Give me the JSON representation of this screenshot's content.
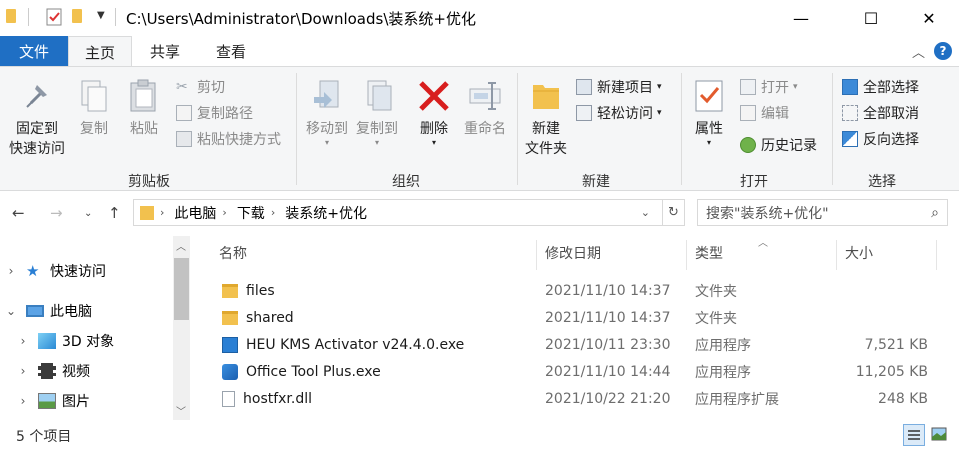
{
  "window": {
    "title": "C:\\Users\\Administrator\\Downloads\\装系统+优化",
    "controls": {
      "minimize": "—",
      "maximize": "☐",
      "close": "✕"
    }
  },
  "ribbon_tabs": {
    "file": "文件",
    "home": "主页",
    "share": "共享",
    "view": "查看"
  },
  "ribbon": {
    "clipboard": {
      "label": "剪贴板",
      "pin": [
        "固定到",
        "快速访问"
      ],
      "copy": "复制",
      "paste": "粘贴",
      "cut": "剪切",
      "copy_path": "复制路径",
      "paste_shortcut": "粘贴快捷方式"
    },
    "organize": {
      "label": "组织",
      "move_to": "移动到",
      "copy_to": "复制到",
      "delete": "删除",
      "rename": "重命名"
    },
    "new": {
      "label": "新建",
      "new_folder": [
        "新建",
        "文件夹"
      ],
      "new_item": "新建项目",
      "easy_access": "轻松访问"
    },
    "open": {
      "label": "打开",
      "properties": "属性",
      "open": "打开",
      "edit": "编辑",
      "history": "历史记录"
    },
    "select": {
      "label": "选择",
      "select_all": "全部选择",
      "select_none": "全部取消",
      "invert": "反向选择"
    }
  },
  "address": {
    "crumbs": [
      "此电脑",
      "下载",
      "装系统+优化"
    ],
    "search_placeholder": "搜索\"装系统+优化\""
  },
  "nav_pane": {
    "items": [
      {
        "label": "快速访问",
        "icon": "star-icon"
      },
      {
        "label": "此电脑",
        "icon": "computer-icon"
      },
      {
        "label": "3D 对象",
        "icon": "cube-icon"
      },
      {
        "label": "视频",
        "icon": "film-icon"
      },
      {
        "label": "图片",
        "icon": "picture-icon"
      }
    ]
  },
  "file_list": {
    "columns": {
      "name": "名称",
      "date": "修改日期",
      "type": "类型",
      "size": "大小"
    },
    "rows": [
      {
        "name": "files",
        "date": "2021/11/10 14:37",
        "type": "文件夹",
        "size": "",
        "icon": "folder-icon"
      },
      {
        "name": "shared",
        "date": "2021/11/10 14:37",
        "type": "文件夹",
        "size": "",
        "icon": "folder-icon"
      },
      {
        "name": "HEU KMS Activator v24.4.0.exe",
        "date": "2021/10/11 23:30",
        "type": "应用程序",
        "size": "7,521 KB",
        "icon": "exe-icon"
      },
      {
        "name": "Office Tool Plus.exe",
        "date": "2021/11/10 14:44",
        "type": "应用程序",
        "size": "11,205 KB",
        "icon": "office-tool-icon"
      },
      {
        "name": "hostfxr.dll",
        "date": "2021/10/22 21:20",
        "type": "应用程序扩展",
        "size": "248 KB",
        "icon": "dll-icon"
      }
    ]
  },
  "status": {
    "item_count": "5 个项目"
  },
  "colors": {
    "accent": "#1f6fc4",
    "folder": "#f2c14e",
    "ribbon_bg": "#f5f6f7",
    "delete_red": "#d81e1e"
  }
}
